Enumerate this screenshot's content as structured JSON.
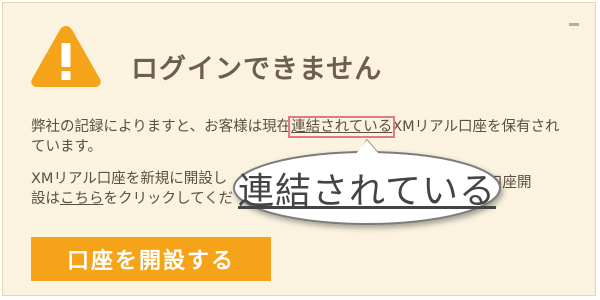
{
  "dialog": {
    "title": "ログインできません",
    "message_pre": "弊社の記録によりますと、お客様は現在",
    "message_highlight": "連結されている",
    "message_post": "XMリアル口座を保有されています。",
    "new_line1_part": "XMリアル口座を新規に開設し",
    "new_line2_pre": "設は",
    "link_text": "こちら",
    "new_line2_post": "をクリックしてくだ",
    "tail_text": "口座開",
    "button_label": "口座を開設する"
  },
  "magnifier": {
    "text": "連結されている"
  },
  "colors": {
    "background": "#fbf3df",
    "accent": "#f5a41a",
    "highlight_box": "#e17a83",
    "text": "#5c4e42"
  },
  "icons": {
    "warning": "warning-icon",
    "minimize": "minimize-icon"
  }
}
